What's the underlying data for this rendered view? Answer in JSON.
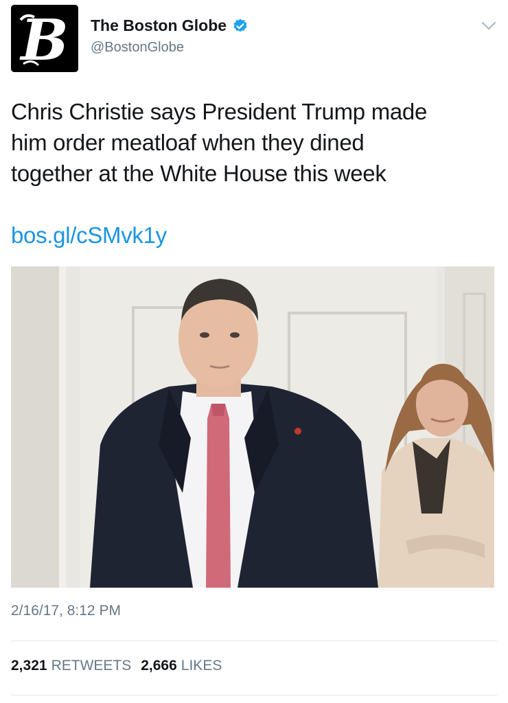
{
  "account": {
    "display_name": "The Boston Globe",
    "handle": "@BostonGlobe",
    "verified": true,
    "avatar_letter": "B"
  },
  "tweet": {
    "text_lines": [
      "Chris Christie says President Trump made",
      "him order meatloaf when they dined",
      "together at the White House this week"
    ],
    "link": "bos.gl/cSMvk1y",
    "timestamp": "2/16/17, 8:12 PM"
  },
  "stats": {
    "retweets_count": "2,321",
    "retweets_label": "RETWEETS",
    "likes_count": "2,666",
    "likes_label": "LIKES"
  },
  "icons": {
    "verified": "verified-badge-icon",
    "menu": "chevron-down-icon"
  },
  "colors": {
    "link": "#1b95e0",
    "verified": "#1da1f2",
    "secondary_text": "#657786"
  }
}
